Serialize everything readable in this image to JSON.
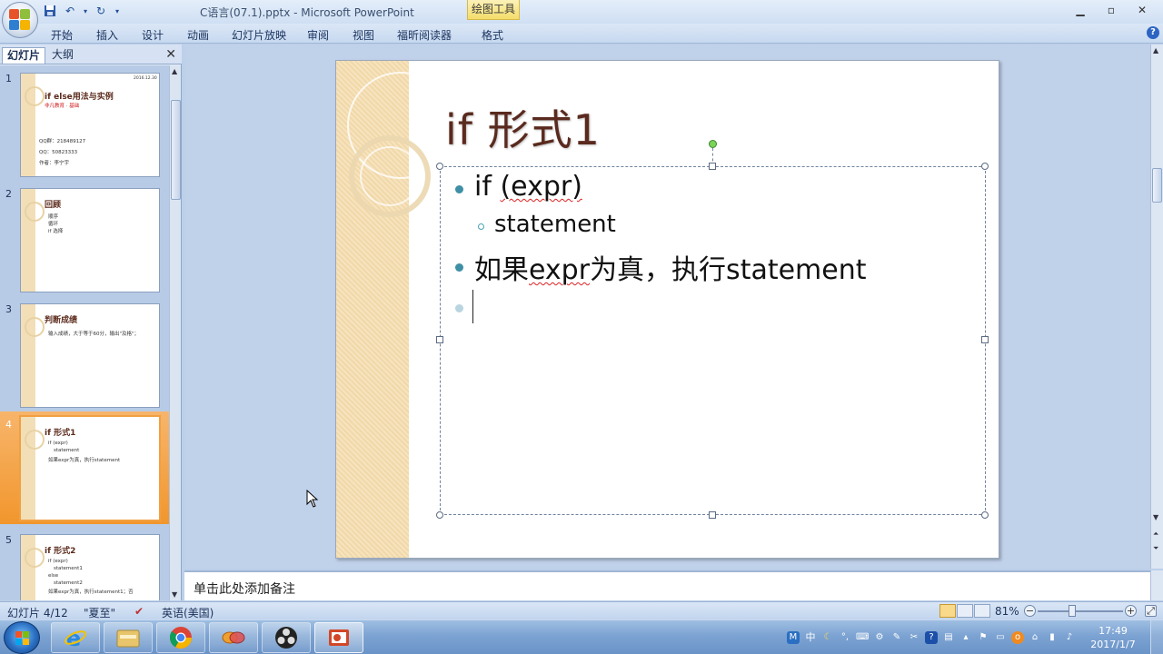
{
  "window": {
    "doc_title": "C语言(07.1).pptx - Microsoft PowerPoint",
    "contextual_tab_title": "绘图工具",
    "minimize": "▁",
    "restore": "▫",
    "close": "✕"
  },
  "ribbon": {
    "tabs": [
      "开始",
      "插入",
      "设计",
      "动画",
      "幻灯片放映",
      "审阅",
      "视图",
      "福昕阅读器",
      "格式"
    ],
    "help": "?"
  },
  "left_panel": {
    "tab_slides": "幻灯片",
    "tab_outline": "大纲",
    "close": "✕",
    "thumbnails": [
      {
        "num": "1",
        "title": "if else用法与实例",
        "sub": "非凡教育 · 基础",
        "lines": [
          "QQ群：218489127",
          "QQ：50823333",
          "作者：李宁宇"
        ],
        "corner": "2016.12.30"
      },
      {
        "num": "2",
        "title": "回顾",
        "lines": [
          "顺序",
          "循环",
          "if 选择"
        ]
      },
      {
        "num": "3",
        "title": "判断成绩",
        "lines": [
          "输入成绩，大于等于60分，输出\"及格\"；"
        ]
      },
      {
        "num": "4",
        "title": "if 形式1",
        "lines": [
          "if (expr)",
          "statement",
          "如果expr为真，执行statement"
        ]
      },
      {
        "num": "5",
        "title": "if 形式2",
        "lines": [
          "if (expr)",
          "statement1",
          "else",
          "statement2",
          "如果expr为真，执行statement1；否"
        ]
      }
    ]
  },
  "slide": {
    "title": "if 形式1",
    "bullets": [
      {
        "level": 1,
        "text_plain": "if ",
        "text_squiggle": "(expr)"
      },
      {
        "level": 2,
        "text_plain": "statement",
        "text_squiggle": ""
      },
      {
        "level": 1,
        "text_plain": "如果",
        "text_squiggle": "expr",
        "text_after": "为真，执行statement"
      },
      {
        "level": 1,
        "text_plain": "",
        "text_squiggle": ""
      }
    ]
  },
  "notes": {
    "placeholder": "单击此处添加备注"
  },
  "status_bar": {
    "slide_indicator": "幻灯片 4/12",
    "theme": "\"夏至\"",
    "language": "英语(美国)",
    "zoom": "81%",
    "zoom_minus": "−",
    "zoom_plus": "+",
    "zoom_level": 0.81
  },
  "taskbar": {
    "apps": [
      "internet-explorer",
      "file-explorer",
      "chrome",
      "app-4",
      "obs",
      "powerpoint"
    ],
    "time": "17:49",
    "date": "2017/1/7",
    "ime": "M",
    "ime_lang": "中"
  },
  "colors": {
    "title": "#5a2a1e",
    "bullet": "#3f8fa6",
    "accent_band": "#f2dfb8",
    "selection": "#f2962d"
  }
}
